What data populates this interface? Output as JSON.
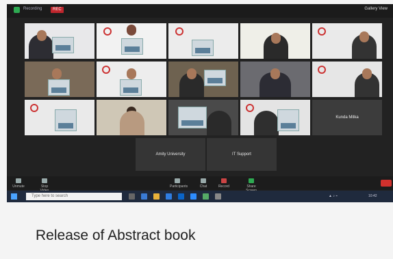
{
  "topbar": {
    "meeting_text": "Recording",
    "rec_label": "REC",
    "view_label": "Gallery View"
  },
  "participants": {
    "name_tile": "Kunda Mitka",
    "bottom_left": "Amity University",
    "bottom_right": "IT Support"
  },
  "controls": {
    "mute": "Unmute",
    "video": "Stop Video",
    "participants": "Participants",
    "chat": "Chat",
    "share": "Share Screen",
    "record": "Record"
  },
  "taskbar": {
    "search_placeholder": "Type here to search",
    "time": "10:42",
    "date": "28-07-2021"
  },
  "caption": "Release of Abstract book",
  "colors": {
    "rec": "#c0262d",
    "active_speaker": "#d9e97a",
    "taskbar": "#1f2a3d"
  }
}
